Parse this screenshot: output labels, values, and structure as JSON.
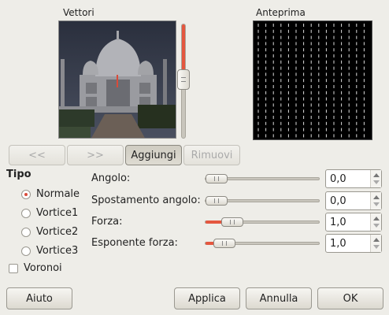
{
  "vectors_label": "Vettori",
  "preview_label": "Anteprima",
  "nav": {
    "prev_label": "<<",
    "next_label": ">>",
    "add_label": "Aggiungi",
    "remove_label": "Rimuovi"
  },
  "tipo": {
    "heading": "Tipo",
    "options": [
      "Normale",
      "Vortice1",
      "Vortice2",
      "Vortice3"
    ],
    "selected": "Normale",
    "voronoi_label": "Voronoi",
    "voronoi_checked": false
  },
  "params": [
    {
      "label": "Angolo:",
      "value": "0,0",
      "level": 0.0
    },
    {
      "label": "Spostamento angolo:",
      "value": "0,0",
      "level": 0.0
    },
    {
      "label": "Forza:",
      "value": "1,0",
      "level": 0.2
    },
    {
      "label": "Esponente forza:",
      "value": "1,0",
      "level": 0.1
    }
  ],
  "footer": {
    "help_label": "Aiuto",
    "apply_label": "Applica",
    "cancel_label": "Annulla",
    "ok_label": "OK"
  },
  "colors": {
    "accent": "#e4573f",
    "preview_bg": "#000000",
    "vector_color": "#d94b3a"
  },
  "icons": {
    "scale_knob": "vertical-slider-knob-icon"
  }
}
